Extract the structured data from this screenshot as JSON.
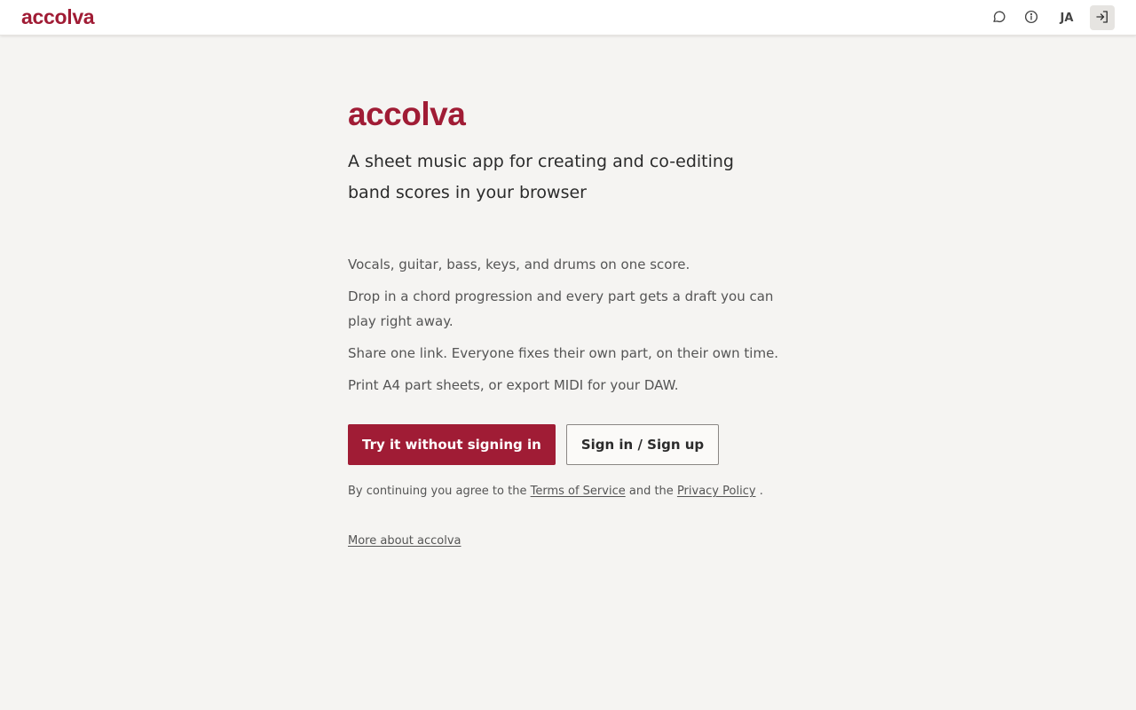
{
  "header": {
    "brand": "accolva",
    "lang_label": "JA"
  },
  "hero": {
    "logo": "accolva",
    "tagline": "A sheet music app for creating and co-editing band scores in your browser",
    "features": [
      "Vocals, guitar, bass, keys, and drums on one score.",
      "Drop in a chord progression and every part gets a draft you can play right away.",
      "Share one link. Everyone fixes their own part, on their own time.",
      "Print A4 part sheets, or export MIDI for your DAW."
    ],
    "primary_cta": "Try it without signing in",
    "secondary_cta": "Sign in / Sign up",
    "legal": {
      "prefix": "By continuing you agree to the",
      "terms": "Terms of Service",
      "middle": "and the",
      "privacy": "Privacy Policy",
      "suffix": "."
    },
    "more_link": "More about accolva"
  },
  "icons": {
    "feedback": "chat-bubble-icon",
    "info": "info-icon",
    "login": "login-arrow-icon"
  },
  "colors": {
    "brand": "#a01c35",
    "background": "#f5f4f2",
    "topbar": "#ffffff"
  }
}
